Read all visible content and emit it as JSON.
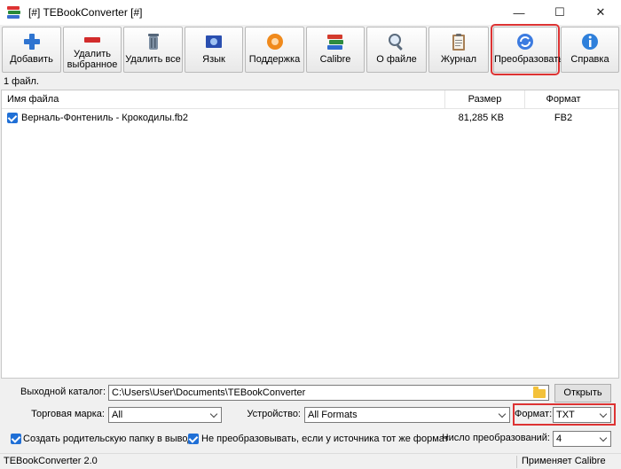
{
  "window": {
    "title": "[#] TEBookConverter [#]",
    "min": "—",
    "max": "☐",
    "close": "✕"
  },
  "toolbar": {
    "buttons": [
      {
        "label": "Добавить",
        "icon": "plus-icon"
      },
      {
        "label": "Удалить выбранное",
        "icon": "minus-icon"
      },
      {
        "label": "Удалить все",
        "icon": "trash-icon"
      },
      {
        "label": "Язык",
        "icon": "flag-icon"
      },
      {
        "label": "Поддержка",
        "icon": "support-icon"
      },
      {
        "label": "Calibre",
        "icon": "books-icon"
      },
      {
        "label": "О файле",
        "icon": "magnifier-icon"
      },
      {
        "label": "Журнал",
        "icon": "clipboard-icon"
      },
      {
        "label": "Преобразовать",
        "icon": "convert-icon"
      },
      {
        "label": "Справка",
        "icon": "info-icon"
      }
    ]
  },
  "file_count": "1 файл.",
  "list": {
    "headers": {
      "name": "Имя файла",
      "size": "Размер",
      "format": "Формат"
    },
    "rows": [
      {
        "checked": true,
        "name": "Верналь-Фонтениль - Крокодилы.fb2",
        "size": "81,285 KB",
        "format": "FB2"
      }
    ]
  },
  "output": {
    "label": "Выходной каталог:",
    "path": "C:\\Users\\User\\Documents\\TEBookConverter",
    "open_label": "Открыть"
  },
  "brand": {
    "label": "Торговая марка:",
    "value": "All"
  },
  "device": {
    "label": "Устройство:",
    "value": "All Formats"
  },
  "format": {
    "label": "Формат:",
    "value": "TXT"
  },
  "options": {
    "create_parent": {
      "label": "Создать родительскую папку в выводе",
      "checked": true
    },
    "skip_same": {
      "label": "Не преобразовывать, если у источника тот же формат",
      "checked": true
    },
    "count_label": "Число преобразований:",
    "count_value": "4"
  },
  "status": {
    "left": "TEBookConverter 2.0",
    "right": "Применяет Calibre"
  },
  "colors": {
    "highlight": "#dd3333",
    "checkbox": "#1f6fd6"
  }
}
